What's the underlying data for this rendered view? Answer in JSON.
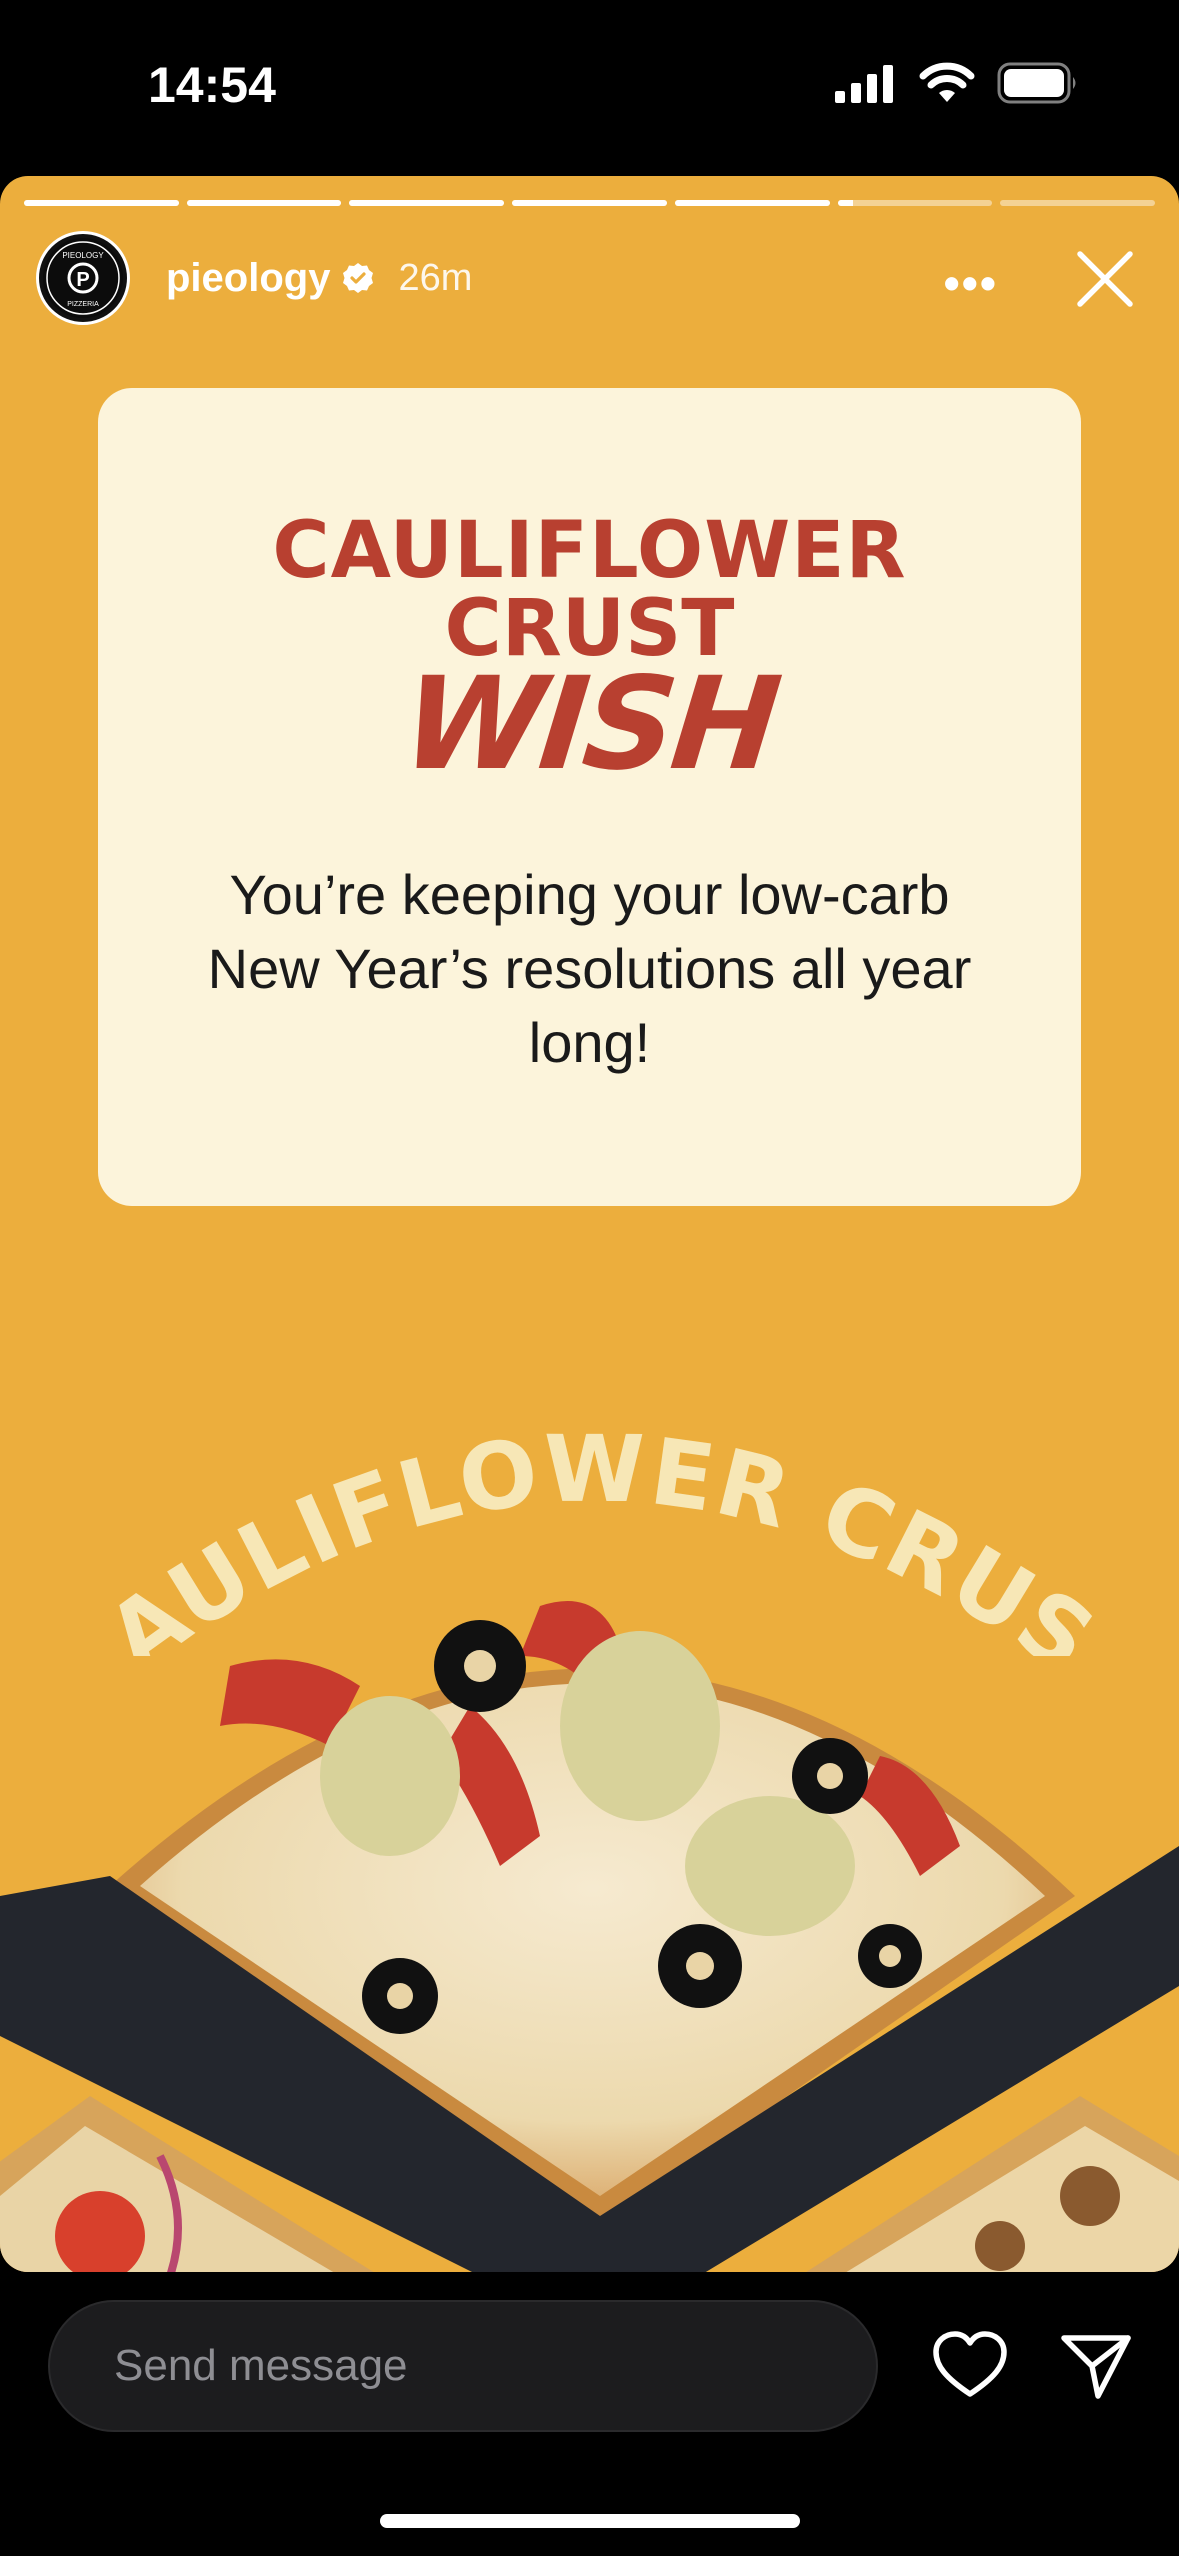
{
  "status_bar": {
    "time": "14:54",
    "icons": [
      "cellular-signal-icon",
      "wifi-icon",
      "battery-icon"
    ]
  },
  "story": {
    "progress": {
      "segments": 7,
      "completed": 5,
      "current_fraction": 0.1
    },
    "header": {
      "username": "pieology",
      "verified": true,
      "time_ago": "26m",
      "avatar_text": [
        "PIEOLOGY",
        "P",
        "PIZZERIA"
      ],
      "more_label": "•••"
    },
    "card": {
      "title_line1": "CAULIFLOWER",
      "title_line2": "CRUST",
      "title_line3": "WISH",
      "body": "You’re keeping your low-carb New Year’s resolutions all year long!"
    },
    "arc_text": "CAULIFLOWER CRUST",
    "colors": {
      "background": "#ecae3d",
      "card_bg": "#fcf4db",
      "title_red": "#b84030",
      "arc_text": "#f7e7b6"
    }
  },
  "bottom_bar": {
    "message_placeholder": "Send message",
    "icons": [
      "heart-icon",
      "send-icon"
    ]
  }
}
